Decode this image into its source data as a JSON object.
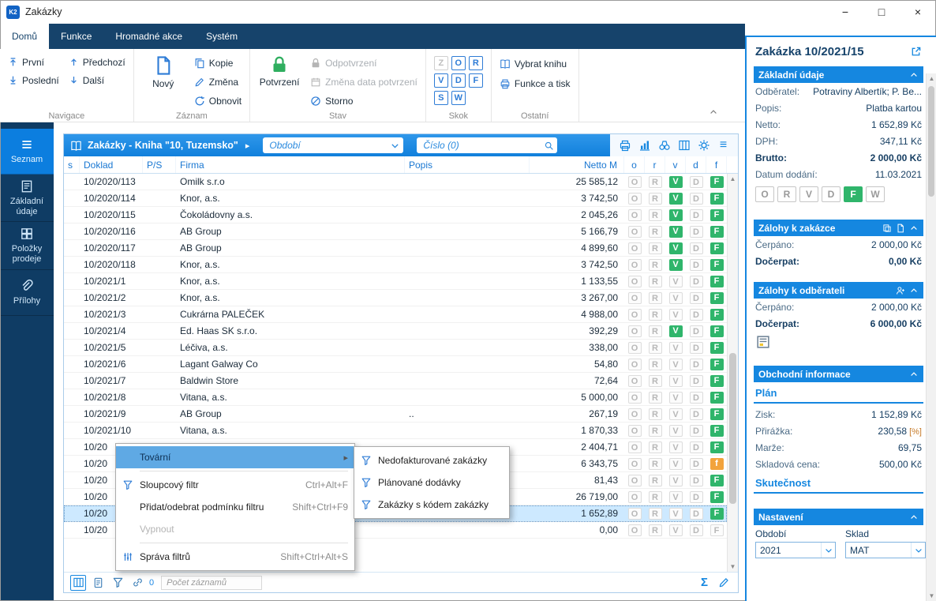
{
  "colors": {
    "accent": "#1587E0",
    "navy": "#16436B",
    "sidebar": "#0F3C64",
    "sidebar-active": "#0C7EDF",
    "green": "#2FB56B",
    "orange": "#F2A33C",
    "selected-row": "#CDE9FF"
  },
  "window": {
    "title": "Zakázky",
    "logo": "K2"
  },
  "ribbon": {
    "tabs": [
      "Domů",
      "Funkce",
      "Hromadné akce",
      "Systém"
    ],
    "groups": {
      "navigace": {
        "label": "Navigace",
        "prvni": "První",
        "posledni": "Poslední",
        "predchozi": "Předchozí",
        "dalsi": "Další"
      },
      "zaznam": {
        "label": "Záznam",
        "novy": "Nový",
        "kopie": "Kopie",
        "zmena": "Změna",
        "obnovit": "Obnovit"
      },
      "stav": {
        "label": "Stav",
        "potvrzeni": "Potvrzení",
        "odpotvrzeni": "Odpotvrzení",
        "zmena_data": "Změna data potvrzení",
        "storno": "Storno"
      },
      "skok": {
        "label": "Skok",
        "letters": [
          "Z",
          "O",
          "R",
          "V",
          "D",
          "F",
          "S",
          "W"
        ]
      },
      "ostatni": {
        "label": "Ostatní",
        "vybrat_knihu": "Vybrat knihu",
        "funkce_tisk": "Funkce a tisk"
      }
    }
  },
  "sidebar": {
    "items": [
      {
        "label": "Seznam",
        "active": true
      },
      {
        "label": "Základní údaje"
      },
      {
        "label": "Položky prodeje"
      },
      {
        "label": "Přílohy"
      }
    ]
  },
  "grid": {
    "title": "Zakázky - Kniha \"10, Tuzemsko\"",
    "filter_obdobi": "Období",
    "filter_cislo": "Číslo (0)",
    "columns": {
      "s": "s",
      "doklad": "Doklad",
      "ps": "P/S",
      "firma": "Firma",
      "popis": "Popis",
      "netto": "Netto M",
      "o": "o",
      "r": "r",
      "v": "v",
      "d": "d",
      "f": "f"
    },
    "rows": [
      {
        "doklad": "10/2020/113",
        "firma": "Omilk s.r.o",
        "popis": "",
        "netto": "25 585,12",
        "flags": [
          [
            "O",
            "off"
          ],
          [
            "R",
            "off"
          ],
          [
            "V",
            "green"
          ],
          [
            "D",
            "off"
          ],
          [
            "F",
            "green"
          ]
        ]
      },
      {
        "doklad": "10/2020/114",
        "firma": "Knor, a.s.",
        "popis": "",
        "netto": "3 742,50",
        "flags": [
          [
            "O",
            "off"
          ],
          [
            "R",
            "off"
          ],
          [
            "V",
            "green"
          ],
          [
            "D",
            "off"
          ],
          [
            "F",
            "green"
          ]
        ]
      },
      {
        "doklad": "10/2020/115",
        "firma": "Čokoládovny a.s.",
        "popis": "",
        "netto": "2 045,26",
        "flags": [
          [
            "O",
            "off"
          ],
          [
            "R",
            "off"
          ],
          [
            "V",
            "green"
          ],
          [
            "D",
            "off"
          ],
          [
            "F",
            "green"
          ]
        ]
      },
      {
        "doklad": "10/2020/116",
        "firma": "AB Group",
        "popis": "",
        "netto": "5 166,79",
        "flags": [
          [
            "O",
            "off"
          ],
          [
            "R",
            "off"
          ],
          [
            "V",
            "green"
          ],
          [
            "D",
            "off"
          ],
          [
            "F",
            "green"
          ]
        ]
      },
      {
        "doklad": "10/2020/117",
        "firma": "AB Group",
        "popis": "",
        "netto": "4 899,60",
        "flags": [
          [
            "O",
            "off"
          ],
          [
            "R",
            "off"
          ],
          [
            "V",
            "green"
          ],
          [
            "D",
            "off"
          ],
          [
            "F",
            "green"
          ]
        ]
      },
      {
        "doklad": "10/2020/118",
        "firma": "Knor, a.s.",
        "popis": "",
        "netto": "3 742,50",
        "flags": [
          [
            "O",
            "off"
          ],
          [
            "R",
            "off"
          ],
          [
            "V",
            "green"
          ],
          [
            "D",
            "off"
          ],
          [
            "F",
            "green"
          ]
        ]
      },
      {
        "doklad": "10/2021/1",
        "firma": "Knor, a.s.",
        "popis": "",
        "netto": "1 133,55",
        "flags": [
          [
            "O",
            "off"
          ],
          [
            "R",
            "off"
          ],
          [
            "V",
            "off"
          ],
          [
            "D",
            "off"
          ],
          [
            "F",
            "green"
          ]
        ]
      },
      {
        "doklad": "10/2021/2",
        "firma": "Knor, a.s.",
        "popis": "",
        "netto": "3 267,00",
        "flags": [
          [
            "O",
            "off"
          ],
          [
            "R",
            "off"
          ],
          [
            "V",
            "off"
          ],
          [
            "D",
            "off"
          ],
          [
            "F",
            "green"
          ]
        ]
      },
      {
        "doklad": "10/2021/3",
        "firma": "Cukrárna PALEČEK",
        "popis": "",
        "netto": "4 988,00",
        "flags": [
          [
            "O",
            "off"
          ],
          [
            "R",
            "off"
          ],
          [
            "V",
            "off"
          ],
          [
            "D",
            "off"
          ],
          [
            "F",
            "green"
          ]
        ]
      },
      {
        "doklad": "10/2021/4",
        "firma": "Ed. Haas SK s.r.o.",
        "popis": "",
        "netto": "392,29",
        "flags": [
          [
            "O",
            "off"
          ],
          [
            "R",
            "off"
          ],
          [
            "V",
            "green"
          ],
          [
            "D",
            "off"
          ],
          [
            "F",
            "green"
          ]
        ]
      },
      {
        "doklad": "10/2021/5",
        "firma": "Léčiva, a.s.",
        "popis": "",
        "netto": "338,00",
        "flags": [
          [
            "O",
            "off"
          ],
          [
            "R",
            "off"
          ],
          [
            "V",
            "off"
          ],
          [
            "D",
            "off"
          ],
          [
            "F",
            "green"
          ]
        ]
      },
      {
        "doklad": "10/2021/6",
        "firma": "Lagant Galway Co",
        "popis": "",
        "netto": "54,80",
        "flags": [
          [
            "O",
            "off"
          ],
          [
            "R",
            "off"
          ],
          [
            "V",
            "off"
          ],
          [
            "D",
            "off"
          ],
          [
            "F",
            "green"
          ]
        ]
      },
      {
        "doklad": "10/2021/7",
        "firma": "Baldwin Store",
        "popis": "",
        "netto": "72,64",
        "flags": [
          [
            "O",
            "off"
          ],
          [
            "R",
            "off"
          ],
          [
            "V",
            "off"
          ],
          [
            "D",
            "off"
          ],
          [
            "F",
            "green"
          ]
        ]
      },
      {
        "doklad": "10/2021/8",
        "firma": "Vitana, a.s.",
        "popis": "",
        "netto": "5 000,00",
        "flags": [
          [
            "O",
            "off"
          ],
          [
            "R",
            "off"
          ],
          [
            "V",
            "off"
          ],
          [
            "D",
            "off"
          ],
          [
            "F",
            "green"
          ]
        ]
      },
      {
        "doklad": "10/2021/9",
        "firma": "AB Group",
        "popis": "..",
        "netto": "267,19",
        "flags": [
          [
            "O",
            "off"
          ],
          [
            "R",
            "off"
          ],
          [
            "V",
            "off"
          ],
          [
            "D",
            "off"
          ],
          [
            "F",
            "green"
          ]
        ]
      },
      {
        "doklad": "10/2021/10",
        "firma": "Vitana, a.s.",
        "popis": "",
        "netto": "1 870,33",
        "flags": [
          [
            "O",
            "off"
          ],
          [
            "R",
            "off"
          ],
          [
            "V",
            "off"
          ],
          [
            "D",
            "off"
          ],
          [
            "F",
            "green"
          ]
        ]
      },
      {
        "doklad": "10/20",
        "firma": "",
        "popis": "",
        "netto": "2 404,71",
        "flags": [
          [
            "O",
            "off"
          ],
          [
            "R",
            "off"
          ],
          [
            "V",
            "off"
          ],
          [
            "D",
            "off"
          ],
          [
            "F",
            "green"
          ]
        ]
      },
      {
        "doklad": "10/20",
        "firma": "",
        "popis": "",
        "netto": "6 343,75",
        "flags": [
          [
            "O",
            "off"
          ],
          [
            "R",
            "off"
          ],
          [
            "V",
            "off"
          ],
          [
            "D",
            "off"
          ],
          [
            "f",
            "orange"
          ]
        ]
      },
      {
        "doklad": "10/20",
        "firma": "",
        "popis": "",
        "netto": "81,43",
        "flags": [
          [
            "O",
            "off"
          ],
          [
            "R",
            "off"
          ],
          [
            "V",
            "off"
          ],
          [
            "D",
            "off"
          ],
          [
            "F",
            "green"
          ]
        ]
      },
      {
        "doklad": "10/20",
        "firma": "",
        "popis": "",
        "netto": "26 719,00",
        "flags": [
          [
            "O",
            "off"
          ],
          [
            "R",
            "off"
          ],
          [
            "V",
            "off"
          ],
          [
            "D",
            "off"
          ],
          [
            "F",
            "green"
          ]
        ]
      },
      {
        "doklad": "10/20",
        "firma": "",
        "popis": "Platba kartou",
        "netto": "1 652,89",
        "selected": true,
        "flags": [
          [
            "O",
            "off"
          ],
          [
            "R",
            "off"
          ],
          [
            "V",
            "off"
          ],
          [
            "D",
            "off"
          ],
          [
            "F",
            "green"
          ]
        ]
      },
      {
        "doklad": "10/20",
        "firma": "",
        "popis": "",
        "netto": "0,00",
        "flags": [
          [
            "O",
            "off"
          ],
          [
            "R",
            "off"
          ],
          [
            "V",
            "off"
          ],
          [
            "D",
            "off"
          ],
          [
            "F",
            "off"
          ]
        ]
      }
    ]
  },
  "context_menu": {
    "tovarni": "Tovární",
    "items": [
      {
        "label": "Sloupcový filtr",
        "shortcut": "Ctrl+Alt+F"
      },
      {
        "label": "Přidat/odebrat podmínku filtru",
        "shortcut": "Shift+Ctrl+F9"
      },
      {
        "label": "Vypnout",
        "shortcut": ""
      },
      {
        "label": "Správa filtrů",
        "shortcut": "Shift+Ctrl+Alt+S"
      }
    ],
    "submenu": [
      "Nedofakturované zakázky",
      "Plánované dodávky",
      "Zakázky s kódem zakázky"
    ]
  },
  "statusbar": {
    "pocet": "Počet záznamů",
    "links": "0"
  },
  "detail": {
    "title": "Zakázka 10/2021/15",
    "zakladni": {
      "header": "Základní údaje",
      "odberatel_label": "Odběratel:",
      "odberatel": "Potraviny Albertík; P. Be...",
      "popis_label": "Popis:",
      "popis": "Platba kartou",
      "netto_label": "Netto:",
      "netto": "1 652,89 Kč",
      "dph_label": "DPH:",
      "dph": "347,11 Kč",
      "brutto_label": "Brutto:",
      "brutto": "2 000,00 Kč",
      "datum_label": "Datum dodání:",
      "datum": "11.03.2021",
      "letters": [
        "O",
        "R",
        "V",
        "D",
        "F",
        "W"
      ]
    },
    "zalohy_zakazce": {
      "header": "Zálohy k zakázce",
      "cerpano_label": "Čerpáno:",
      "cerpano": "2 000,00 Kč",
      "docerpat_label": "Dočerpat:",
      "docerpat": "0,00 Kč"
    },
    "zalohy_odberateli": {
      "header": "Zálohy k odběrateli",
      "cerpano_label": "Čerpáno:",
      "cerpano": "2 000,00 Kč",
      "docerpat_label": "Dočerpat:",
      "docerpat": "6 000,00 Kč"
    },
    "obchodni": {
      "header": "Obchodní informace",
      "plan": "Plán",
      "zisk_label": "Zisk:",
      "zisk": "1 152,89 Kč",
      "prirazka_label": "Přirážka:",
      "prirazka": "230,58",
      "prirazka_unit": "[%]",
      "marze_label": "Marže:",
      "marze": "69,75",
      "sklad_cena_label": "Skladová cena:",
      "sklad_cena": "500,00 Kč",
      "skutecnost": "Skutečnost"
    },
    "nastaveni": {
      "header": "Nastavení",
      "obdobi_label": "Období",
      "obdobi": "2021",
      "sklad_label": "Sklad",
      "sklad": "MAT"
    }
  }
}
